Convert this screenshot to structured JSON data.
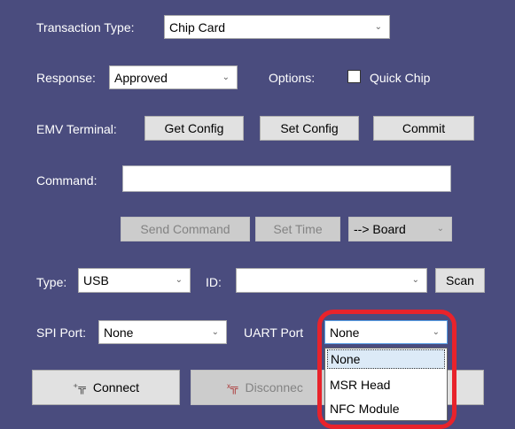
{
  "transaction": {
    "label": "Transaction Type:",
    "value": "Chip Card"
  },
  "response": {
    "label": "Response:",
    "value": "Approved"
  },
  "options": {
    "label": "Options:",
    "quick_chip_label": "Quick Chip",
    "quick_chip_checked": false
  },
  "emv": {
    "label": "EMV Terminal:",
    "get_config": "Get Config",
    "set_config": "Set Config",
    "commit": "Commit"
  },
  "command": {
    "label": "Command:",
    "value": ""
  },
  "actions": {
    "send_command": "Send Command",
    "set_time": "Set Time",
    "direction": "--> Board"
  },
  "connection": {
    "type_label": "Type:",
    "type_value": "USB",
    "id_label": "ID:",
    "id_value": "",
    "scan": "Scan"
  },
  "ports": {
    "spi_label": "SPI Port:",
    "spi_value": "None",
    "uart_label": "UART Port",
    "uart_value": "None"
  },
  "uart_dropdown": {
    "options": [
      "None",
      "MSR Head",
      "NFC Module"
    ],
    "selected": "None"
  },
  "buttons": {
    "connect": "Connect",
    "disconnect": "Disconnec"
  },
  "icons": {
    "connect": "plug-connect-icon",
    "disconnect": "plug-disconnect-icon",
    "arrow": "chevron-down-icon"
  },
  "colors": {
    "background": "#4a4c7e",
    "highlight": "#e8232b"
  }
}
